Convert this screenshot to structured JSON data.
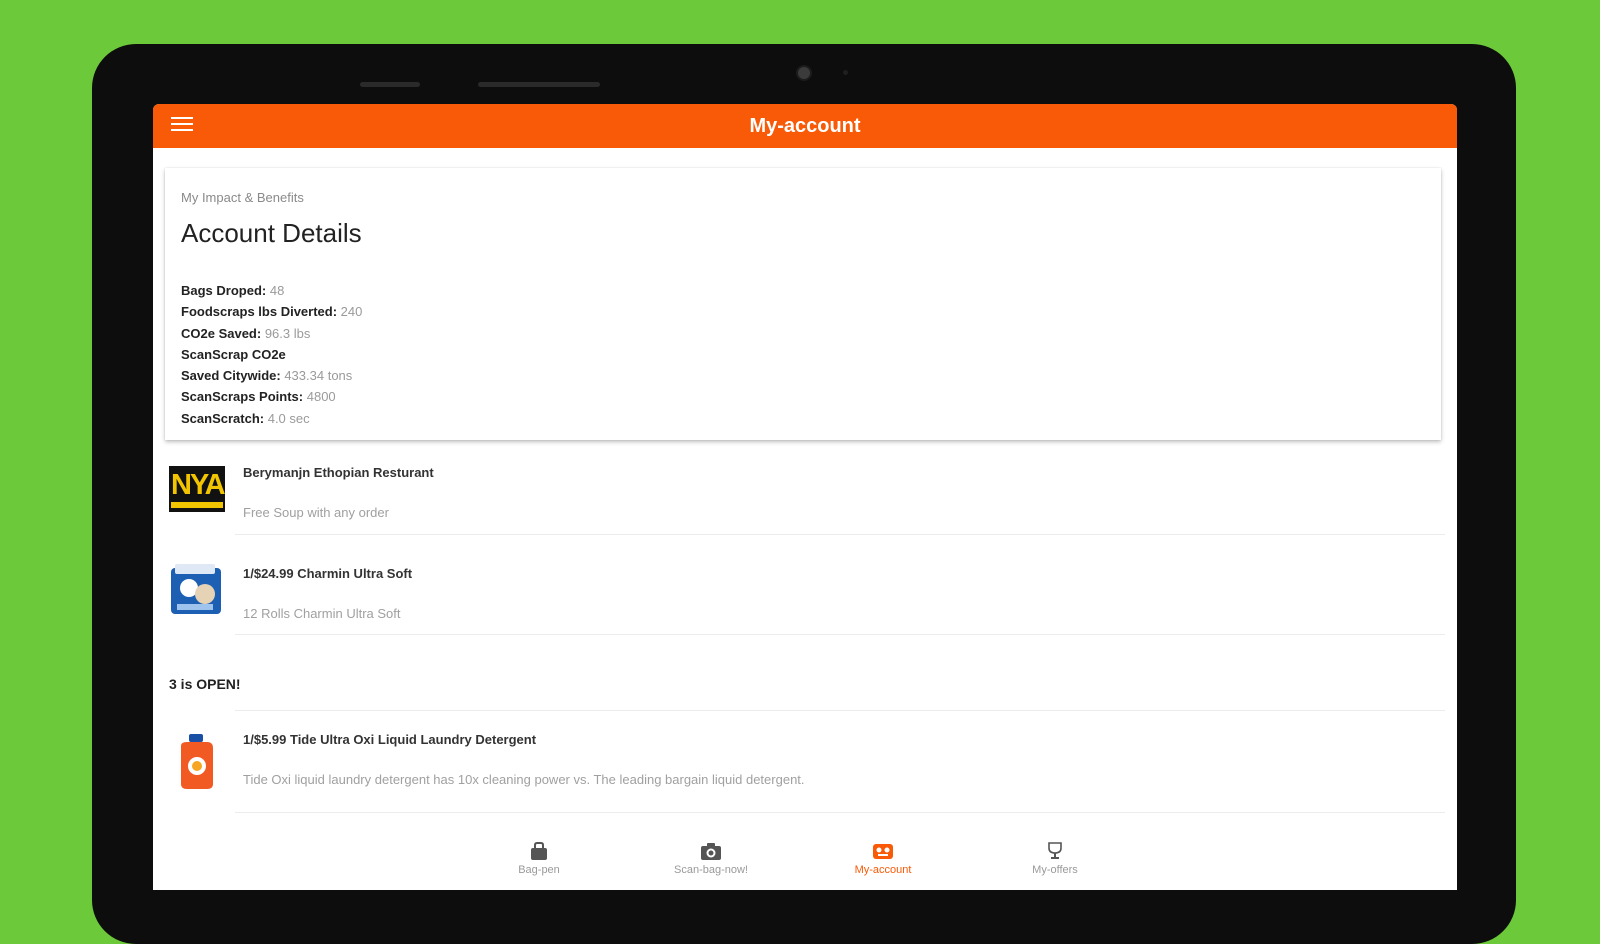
{
  "appbar": {
    "title": "My-account"
  },
  "card": {
    "overline": "My Impact & Benefits",
    "title": "Account Details",
    "stats": [
      {
        "label": "Bags Droped:",
        "value": "48"
      },
      {
        "label": "Foodscraps lbs Diverted:",
        "value": "240"
      },
      {
        "label": "CO2e Saved:",
        "value": "96.3 lbs"
      },
      {
        "label": "ScanScrap CO2e",
        "value": ""
      },
      {
        "label": "Saved Citywide:",
        "value": "433.34 tons"
      },
      {
        "label": "ScanScraps Points:",
        "value": "4800"
      },
      {
        "label": "ScanScratch:",
        "value": "4.0 sec"
      }
    ]
  },
  "offers": [
    {
      "title": "Berymanjn Ethopian Resturant",
      "subtitle": "Free Soup with any order",
      "thumb_text": "NYA"
    },
    {
      "title": "1/$24.99 Charmin Ultra Soft",
      "subtitle": "12 Rolls Charmin Ultra Soft"
    }
  ],
  "section_header": "3 is OPEN!",
  "offers2": [
    {
      "title": "1/$5.99 Tide Ultra Oxi Liquid Laundry Detergent",
      "subtitle": "Tide Oxi liquid laundry detergent has 10x cleaning power vs. The leading bargain liquid detergent."
    }
  ],
  "bottom_nav": [
    {
      "label": "Bag-pen",
      "icon": "bag-icon"
    },
    {
      "label": "Scan-bag-now!",
      "icon": "camera-icon"
    },
    {
      "label": "My-account",
      "icon": "account-icon",
      "active": true
    },
    {
      "label": "My-offers",
      "icon": "trophy-icon"
    }
  ],
  "colors": {
    "brand": "#f95a07",
    "background": "#6cc93a"
  }
}
